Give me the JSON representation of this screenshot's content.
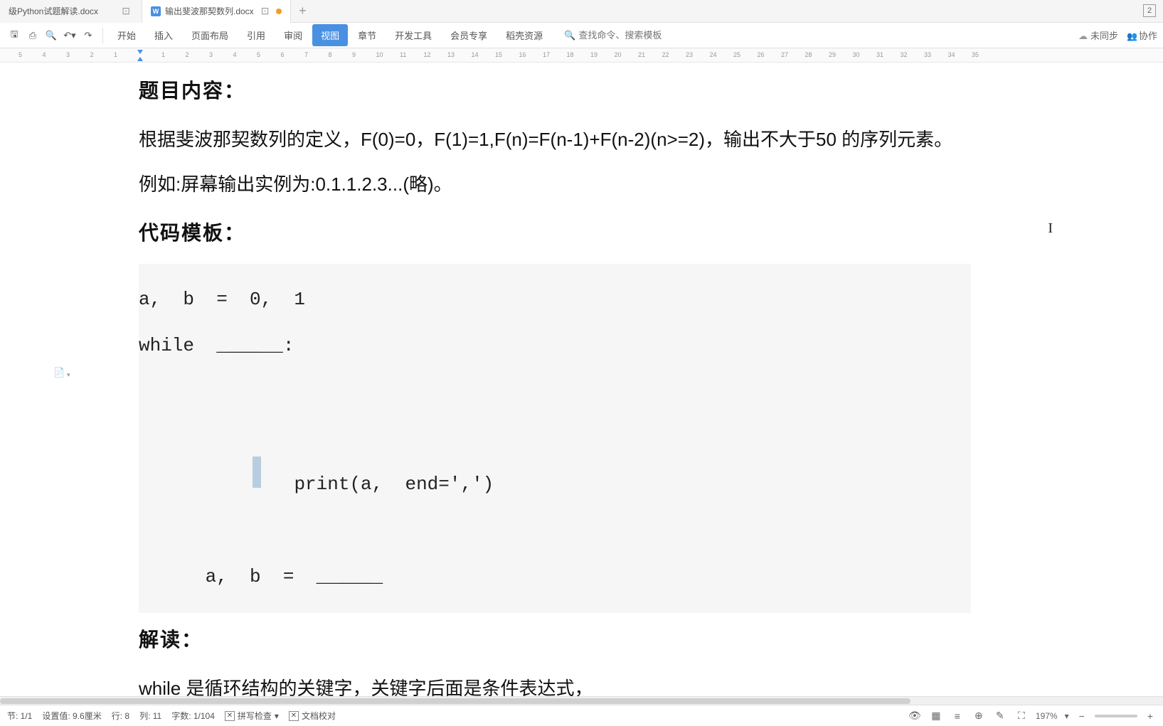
{
  "tabs": [
    {
      "title": "级Python试题解读.docx",
      "active": false,
      "modified": false
    },
    {
      "title": "输出斐波那契数列.docx",
      "active": true,
      "modified": true
    }
  ],
  "tab_count_badge": "2",
  "menu": {
    "items": [
      "开始",
      "插入",
      "页面布局",
      "引用",
      "审阅",
      "视图",
      "章节",
      "开发工具",
      "会员专享",
      "稻壳资源"
    ],
    "active_index": 5
  },
  "search": {
    "placeholder": "查找命令、搜索模板"
  },
  "toolbar_right": {
    "unsynced": "未同步",
    "collab": "协作"
  },
  "ruler_ticks": [
    "5",
    "4",
    "3",
    "2",
    "1",
    "",
    "1",
    "2",
    "3",
    "4",
    "5",
    "6",
    "7",
    "8",
    "9",
    "10",
    "11",
    "12",
    "13",
    "14",
    "15",
    "16",
    "17",
    "18",
    "19",
    "20",
    "21",
    "22",
    "23",
    "24",
    "25",
    "26",
    "27",
    "28",
    "29",
    "30",
    "31",
    "32",
    "33",
    "34",
    "35"
  ],
  "doc": {
    "h1": "题目内容：",
    "p1": "根据斐波那契数列的定义，F(0)=0，F(1)=1,F(n)=F(n-1)+F(n-2)(n>=2)，输出不大于50 的序列元素。例如:屏幕输出实例为:0.1.1.2.3...(略)。",
    "h2": "代码模板：",
    "code": [
      "a,  b  =  0,  1",
      "while  ______:",
      "      print(a,  end=',')",
      "      a,  b  =  ______"
    ],
    "h3": "解读：",
    "p2": "while 是循环结构的关键字，关键字后面是条件表达式，"
  },
  "status": {
    "section": "节: 1/1",
    "setting": "设置值: 9.6厘米",
    "line": "行: 8",
    "col": "列: 11",
    "words": "字数: 1/104",
    "spell": "拼写检查",
    "proof": "文档校对",
    "zoom": "197%"
  }
}
